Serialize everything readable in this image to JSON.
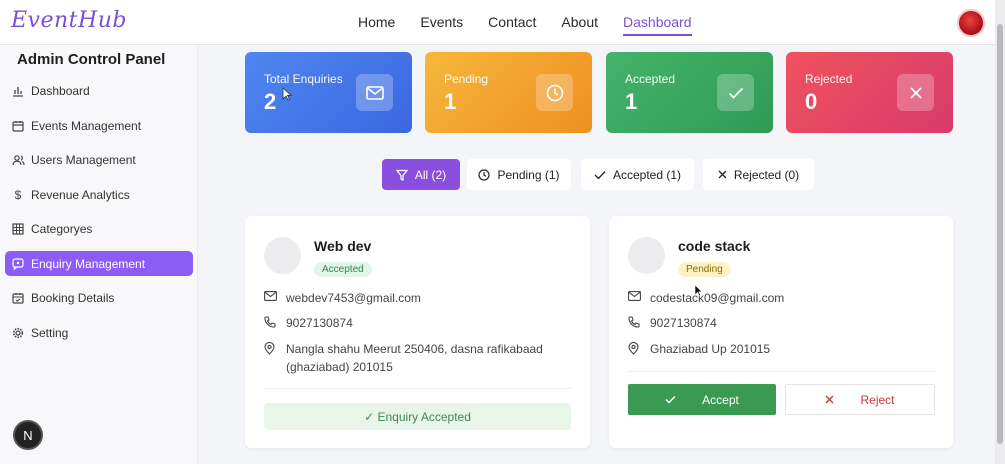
{
  "app": {
    "brand": "EventHub"
  },
  "nav": {
    "items": [
      "Home",
      "Events",
      "Contact",
      "About",
      "Dashboard"
    ],
    "active": "Dashboard"
  },
  "sidebar": {
    "title": "Admin Control Panel",
    "items": [
      {
        "label": "Dashboard",
        "icon": "bar-chart-icon"
      },
      {
        "label": "Events Management",
        "icon": "calendar-icon"
      },
      {
        "label": "Users Management",
        "icon": "users-icon"
      },
      {
        "label": "Revenue Analytics",
        "icon": "dollar-icon"
      },
      {
        "label": "Categoryes",
        "icon": "grid-icon"
      },
      {
        "label": "Enquiry Management",
        "icon": "message-icon",
        "active": true
      },
      {
        "label": "Booking Details",
        "icon": "calendar-check-icon"
      },
      {
        "label": "Setting",
        "icon": "gear-icon"
      }
    ],
    "floating_badge": "N"
  },
  "stats": [
    {
      "label": "Total Enquiries",
      "value": "2",
      "icon": "mail-icon",
      "color": "#4f86f0"
    },
    {
      "label": "Pending",
      "value": "1",
      "icon": "clock-icon",
      "color": "#f6b73c"
    },
    {
      "label": "Accepted",
      "value": "1",
      "icon": "check-icon",
      "color": "#45b36b"
    },
    {
      "label": "Rejected",
      "value": "0",
      "icon": "x-icon",
      "color": "#f0525d"
    }
  ],
  "filters": [
    {
      "label": "All (2)",
      "icon": "funnel-icon",
      "active": true
    },
    {
      "label": "Pending (1)",
      "icon": "clock-icon"
    },
    {
      "label": "Accepted (1)",
      "icon": "check-icon"
    },
    {
      "label": "Rejected (0)",
      "icon": "x-icon"
    }
  ],
  "enquiries": [
    {
      "name": "Web dev",
      "status": "Accepted",
      "email": "webdev7453@gmail.com",
      "phone": "9027130874",
      "address_line1": "Nangla shahu Meerut 250406, dasna rafikabaad",
      "address_line2": "(ghaziabad) 201015",
      "accepted_text": "✓ Enquiry Accepted"
    },
    {
      "name": "code stack",
      "status": "Pending",
      "email": "codestack09@gmail.com",
      "phone": "9027130874",
      "address_line1": "Ghaziabad Up 201015",
      "accept_label": "Accept",
      "reject_label": "Reject"
    }
  ],
  "colors": {
    "accent": "#8b5cf6",
    "accept": "#3a9a52",
    "reject": "#c43a3a"
  }
}
